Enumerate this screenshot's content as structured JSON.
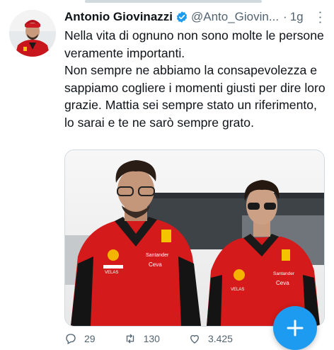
{
  "tweet": {
    "author_name": "Antonio Giovinazzi",
    "author_handle": "@Anto_Giovin...",
    "separator": "·",
    "time": "1g",
    "text": "Nella vita di ognuno non sono molte le persone veramente importanti.\nNon sempre ne abbiamo la consapevolezza e sappiamo cogliere i momenti giusti per dire loro grazie. Mattia sei sempre stato un riferimento, lo sarai e te ne sarò sempre grato.",
    "media": {
      "left_jacket_text": [
        "Santander",
        "Ceva",
        "VELAS"
      ],
      "right_jacket_text": [
        "Santander",
        "Ceva",
        "VELAS"
      ]
    },
    "actions": {
      "replies": "29",
      "retweets": "130",
      "likes": "3.425"
    }
  },
  "colors": {
    "accent": "#1d9bf0",
    "ferrari_red": "#d41a1a",
    "text_secondary": "#536471"
  },
  "icons": [
    "verified-badge-icon",
    "more-icon",
    "reply-icon",
    "retweet-icon",
    "like-icon",
    "compose-icon"
  ]
}
